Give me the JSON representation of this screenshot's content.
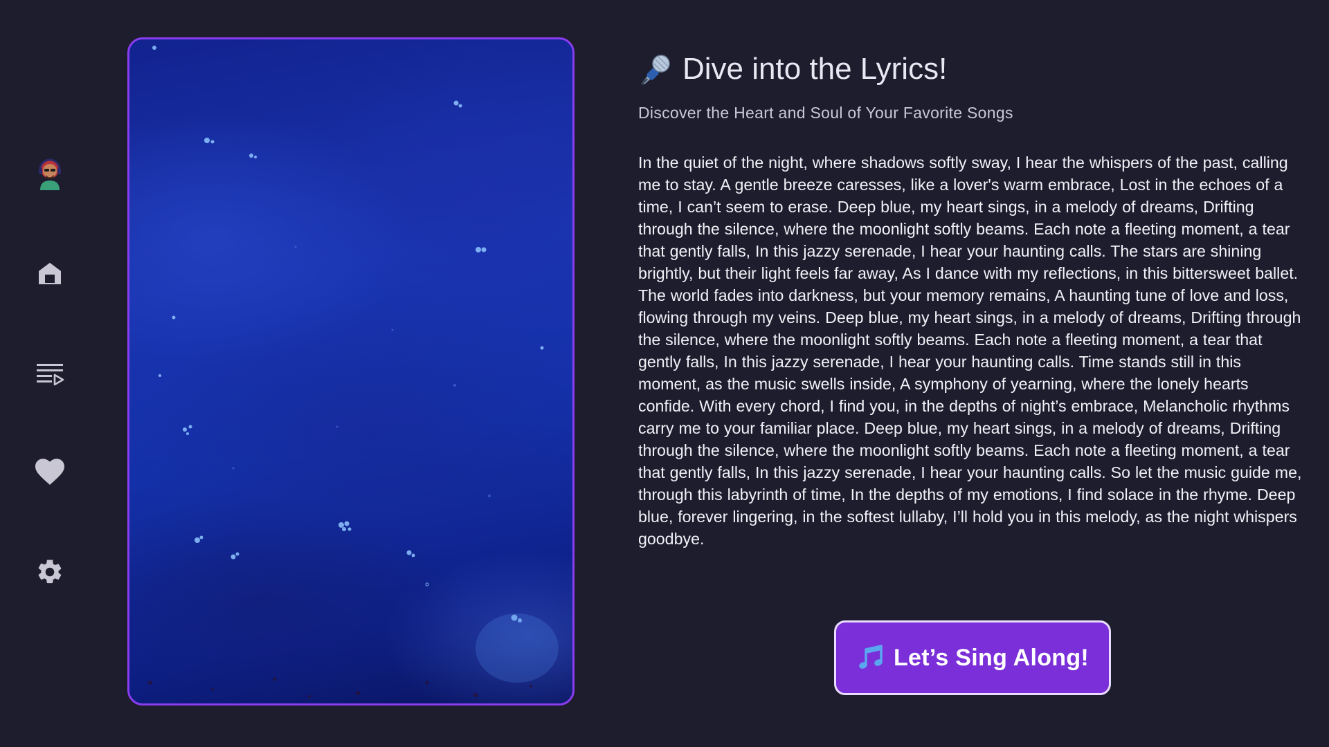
{
  "sidebar": {
    "items": [
      {
        "name": "avatar",
        "icon": "avatar-icon"
      },
      {
        "name": "home",
        "icon": "home-icon"
      },
      {
        "name": "queue",
        "icon": "playlist-play-icon"
      },
      {
        "name": "favorites",
        "icon": "heart-icon"
      },
      {
        "name": "settings",
        "icon": "gear-icon"
      }
    ],
    "icon_color": "#c9c7d3"
  },
  "artwork": {
    "border_color": "#8a3cf0",
    "description_icon": "deep-blue-water-image"
  },
  "header": {
    "title_icon": "microphone-icon",
    "title": "Dive into the Lyrics!",
    "subtitle": "Discover the Heart and Soul of Your Favorite Songs"
  },
  "lyrics": "In the quiet of the night, where shadows softly sway,   I hear the whispers of the past, calling me to stay.   A gentle breeze caresses, like a lover's warm embrace,   Lost in the echoes of a time, I can’t seem to erase.    Deep blue, my heart sings, in a melody of dreams,   Drifting through the silence, where the moonlight softly beams.   Each note a fleeting moment, a tear that gently falls,   In this jazzy serenade, I hear your haunting calls.    The stars are shining brightly, but their light feels far away,   As I dance with my reflections, in this bittersweet ballet.   The world fades into darkness, but your memory remains,   A haunting tune of love and loss, flowing through my veins.    Deep blue, my heart sings, in a melody of dreams,   Drifting through the silence, where the moonlight softly beams.   Each note a fleeting moment, a tear that gently falls,   In this jazzy serenade, I hear your haunting calls.    Time stands still in this moment, as the music swells inside,   A symphony of yearning, where the lonely hearts confide.   With every chord, I find you, in the depths of night’s embrace,   Melancholic rhythms carry me to your familiar place.    Deep blue, my heart sings, in a melody of dreams,   Drifting through the silence, where the moonlight softly beams.   Each note a fleeting moment, a tear that gently falls,   In this jazzy serenade, I hear your haunting calls.    So let the music guide me, through this labyrinth of time,   In the depths of my emotions, I find solace in the rhyme.   Deep blue, forever lingering, in the softest lullaby,   I’ll hold you in this melody, as the night whispers goodbye.",
  "action": {
    "icon": "musical-notes-icon",
    "label": "Let’s Sing Along!",
    "background": "#7b2fd8",
    "border": "#e9dcff"
  }
}
